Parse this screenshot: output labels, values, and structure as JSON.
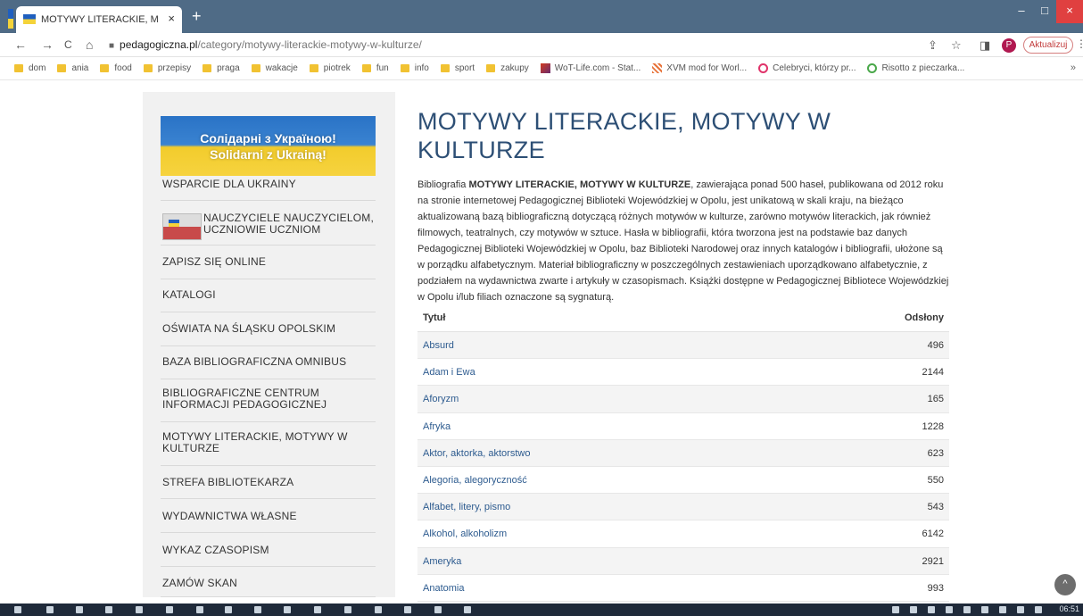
{
  "browser": {
    "tab_title": "MOTYWY LITERACKIE, MOTYWY",
    "tab_close": "×",
    "new_tab": "+",
    "url_host": "pedagogiczna.pl",
    "url_path": "/category/motywy-literackie-motywy-w-kulturze/",
    "update_button": "Aktualizuj",
    "profile_initial": "P",
    "nav": {
      "back": "←",
      "forward": "→",
      "reload": "C",
      "home": "⌂"
    },
    "window": {
      "minimize": "–",
      "maximize": "□",
      "close": "×"
    },
    "address_icons": {
      "share": "⇪",
      "star": "☆",
      "sidepanel": "◨",
      "menu": "⋮"
    },
    "bookmarks_more": "»"
  },
  "bookmarks": [
    {
      "label": "dom",
      "icon": "folder-icon"
    },
    {
      "label": "ania",
      "icon": "folder-icon"
    },
    {
      "label": "food",
      "icon": "folder-icon"
    },
    {
      "label": "przepisy",
      "icon": "folder-icon"
    },
    {
      "label": "praga",
      "icon": "folder-icon"
    },
    {
      "label": "wakacje",
      "icon": "folder-icon"
    },
    {
      "label": "piotrek",
      "icon": "folder-icon"
    },
    {
      "label": "fun",
      "icon": "folder-icon"
    },
    {
      "label": "info",
      "icon": "folder-icon"
    },
    {
      "label": "sport",
      "icon": "folder-icon"
    },
    {
      "label": "zakupy",
      "icon": "folder-icon"
    },
    {
      "label": "WoT-Life.com - Stat...",
      "icon": "wot-icon"
    },
    {
      "label": "XVM mod for Worl...",
      "icon": "xvm-icon"
    },
    {
      "label": "Celebryci, którzy pr...",
      "icon": "celebrity-icon"
    },
    {
      "label": "Risotto z pieczarka...",
      "icon": "risotto-icon"
    }
  ],
  "sidebar": {
    "banner_line1": "Солідарні з Україною!",
    "banner_line2": "Solidarni z Ukrainą!",
    "items": [
      "WSPARCIE DLA UKRAINY",
      "NAUCZYCIELE NAUCZYCIELOM,\nUCZNIOWIE UCZNIOM",
      "ZAPISZ SIĘ ONLINE",
      "KATALOGI",
      "OŚWIATA NA ŚLĄSKU OPOLSKIM",
      "BAZA BIBLIOGRAFICZNA OMNIBUS",
      "BIBLIOGRAFICZNE CENTRUM\nINFORMACJI PEDAGOGICZNEJ",
      "MOTYWY LITERACKIE, MOTYWY W\nKULTURZE",
      "STREFA BIBLIOTEKARZA",
      "WYDAWNICTWA WŁASNE",
      "WYKAZ CZASOPISM",
      "ZAMÓW SKAN"
    ]
  },
  "main": {
    "title": "MOTYWY LITERACKIE, MOTYWY W KULTURZE",
    "intro_prefix": "Bibliografia ",
    "intro_bold": "MOTYWY LITERACKIE, MOTYWY W KULTURZE",
    "intro_rest": ", zawierająca ponad 500 haseł, publikowana od 2012 roku na stronie internetowej Pedagogicznej Biblioteki Wojewódzkiej w Opolu, jest unikatową w skali kraju, na bieżąco aktualizowaną bazą bibliograficzną dotyczącą różnych motywów w kulturze, zarówno motywów literackich, jak również filmowych, teatralnych, czy motywów w sztuce. Hasła w bibliografii, która tworzona jest na podstawie baz danych Pedagogicznej Biblioteki Wojewódzkiej w Opolu, baz Biblioteki Narodowej oraz innych katalogów i bibliografii, ułożone są w porządku alfabetycznym. Materiał bibliograficzny w poszczególnych zestawieniach uporządkowano alfabetycznie, z podziałem na wydawnictwa zwarte i artykuły w czasopismach. Książki dostępne w Pedagogicznej Bibliotece Wojewódzkiej w Opolu i/lub filiach oznaczone są sygnaturą.",
    "table": {
      "col_title": "Tytuł",
      "col_views": "Odsłony",
      "rows": [
        {
          "title": "Absurd",
          "views": "496"
        },
        {
          "title": "Adam i Ewa",
          "views": "2144"
        },
        {
          "title": "Aforyzm",
          "views": "165"
        },
        {
          "title": "Afryka",
          "views": "1228"
        },
        {
          "title": "Aktor, aktorka, aktorstwo",
          "views": "623"
        },
        {
          "title": "Alegoria, alegoryczność",
          "views": "550"
        },
        {
          "title": "Alfabet, litery, pismo",
          "views": "543"
        },
        {
          "title": "Alkohol, alkoholizm",
          "views": "6142"
        },
        {
          "title": "Ameryka",
          "views": "2921"
        },
        {
          "title": "Anatomia",
          "views": "993"
        }
      ]
    },
    "scroll_top": "^"
  },
  "taskbar": {
    "clock": "06:51"
  },
  "colors": {
    "title": "#2d4f75",
    "link": "#2d5b8f",
    "sidebar_bg": "#f1f1f1",
    "tabbar": "#4f6b86"
  }
}
